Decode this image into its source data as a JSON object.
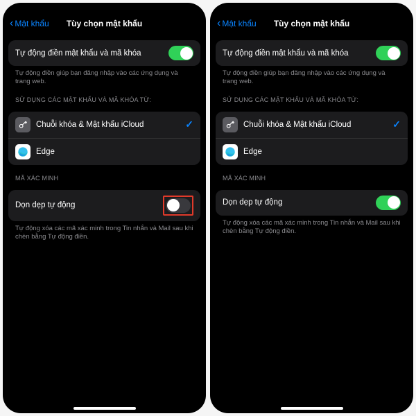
{
  "nav": {
    "back_label": "Mật khẩu",
    "title": "Tùy chọn mật khẩu"
  },
  "autofill": {
    "row_label": "Tự động điền mật khẩu và mã khóa",
    "footer": "Tự động điền giúp bạn đăng nhập vào các ứng dụng và trang web."
  },
  "sources": {
    "header": "SỬ DỤNG CÁC MẬT KHẨU VÀ MÃ KHÓA TỪ:",
    "items": [
      {
        "label": "Chuỗi khóa & Mật khẩu iCloud",
        "checked": true
      },
      {
        "label": "Edge",
        "checked": false
      }
    ]
  },
  "verification": {
    "header": "MÃ XÁC MINH",
    "row_label": "Dọn dẹp tự động",
    "footer": "Tự động xóa các mã xác minh trong Tin nhắn và Mail sau khi chèn bằng Tự động điền."
  },
  "states": {
    "left_cleanup_on": false,
    "right_cleanup_on": true
  }
}
